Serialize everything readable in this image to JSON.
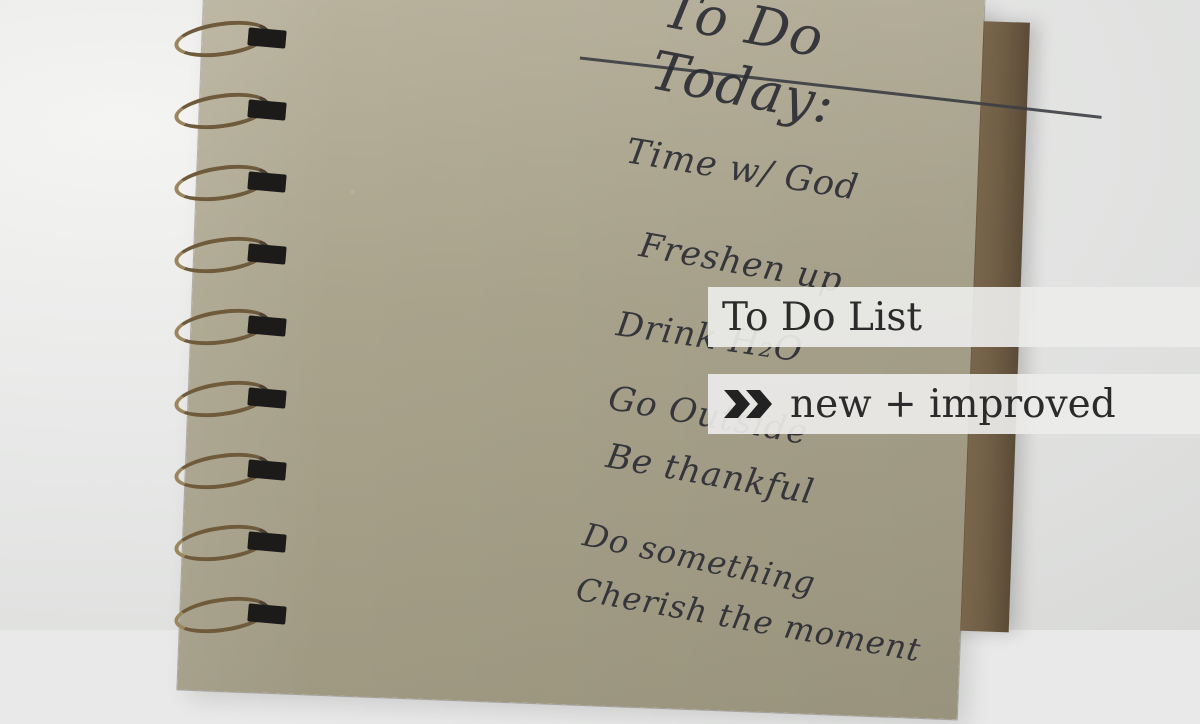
{
  "overlay": {
    "title": "To Do List",
    "subtitle": "new + improved",
    "subtitle_icon": "double-chevron-right-icon"
  }
}
